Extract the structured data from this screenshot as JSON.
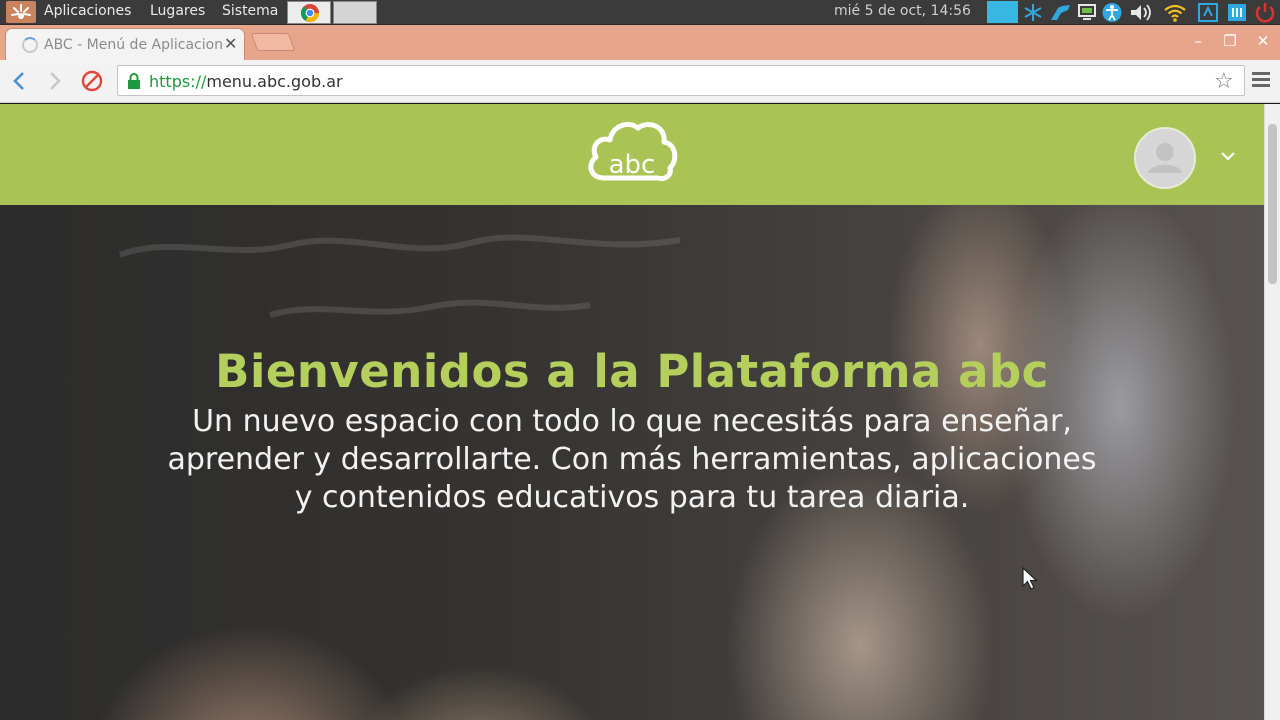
{
  "system_panel": {
    "menus": [
      "Aplicaciones",
      "Lugares",
      "Sistema"
    ],
    "clock": "mié  5 de oct, 14:56"
  },
  "tab": {
    "title": "ABC - Menú de Aplicaciones",
    "close_icon": "close-icon"
  },
  "toolbar": {
    "url_scheme": "https://",
    "url_host": "menu.abc.gob.ar"
  },
  "header": {
    "logo_text": "abc"
  },
  "hero": {
    "title": "Bienvenidos a la Plataforma abc",
    "subtitle": "Un nuevo espacio con todo lo que necesitás para enseñar, aprender y desarrollarte. Con más herramientas, aplicaciones y contenidos educativos para tu tarea diaria."
  },
  "colors": {
    "brand_green": "#a9c354",
    "title_green": "#b4cf5c",
    "tab_strip": "#e7a58b"
  }
}
